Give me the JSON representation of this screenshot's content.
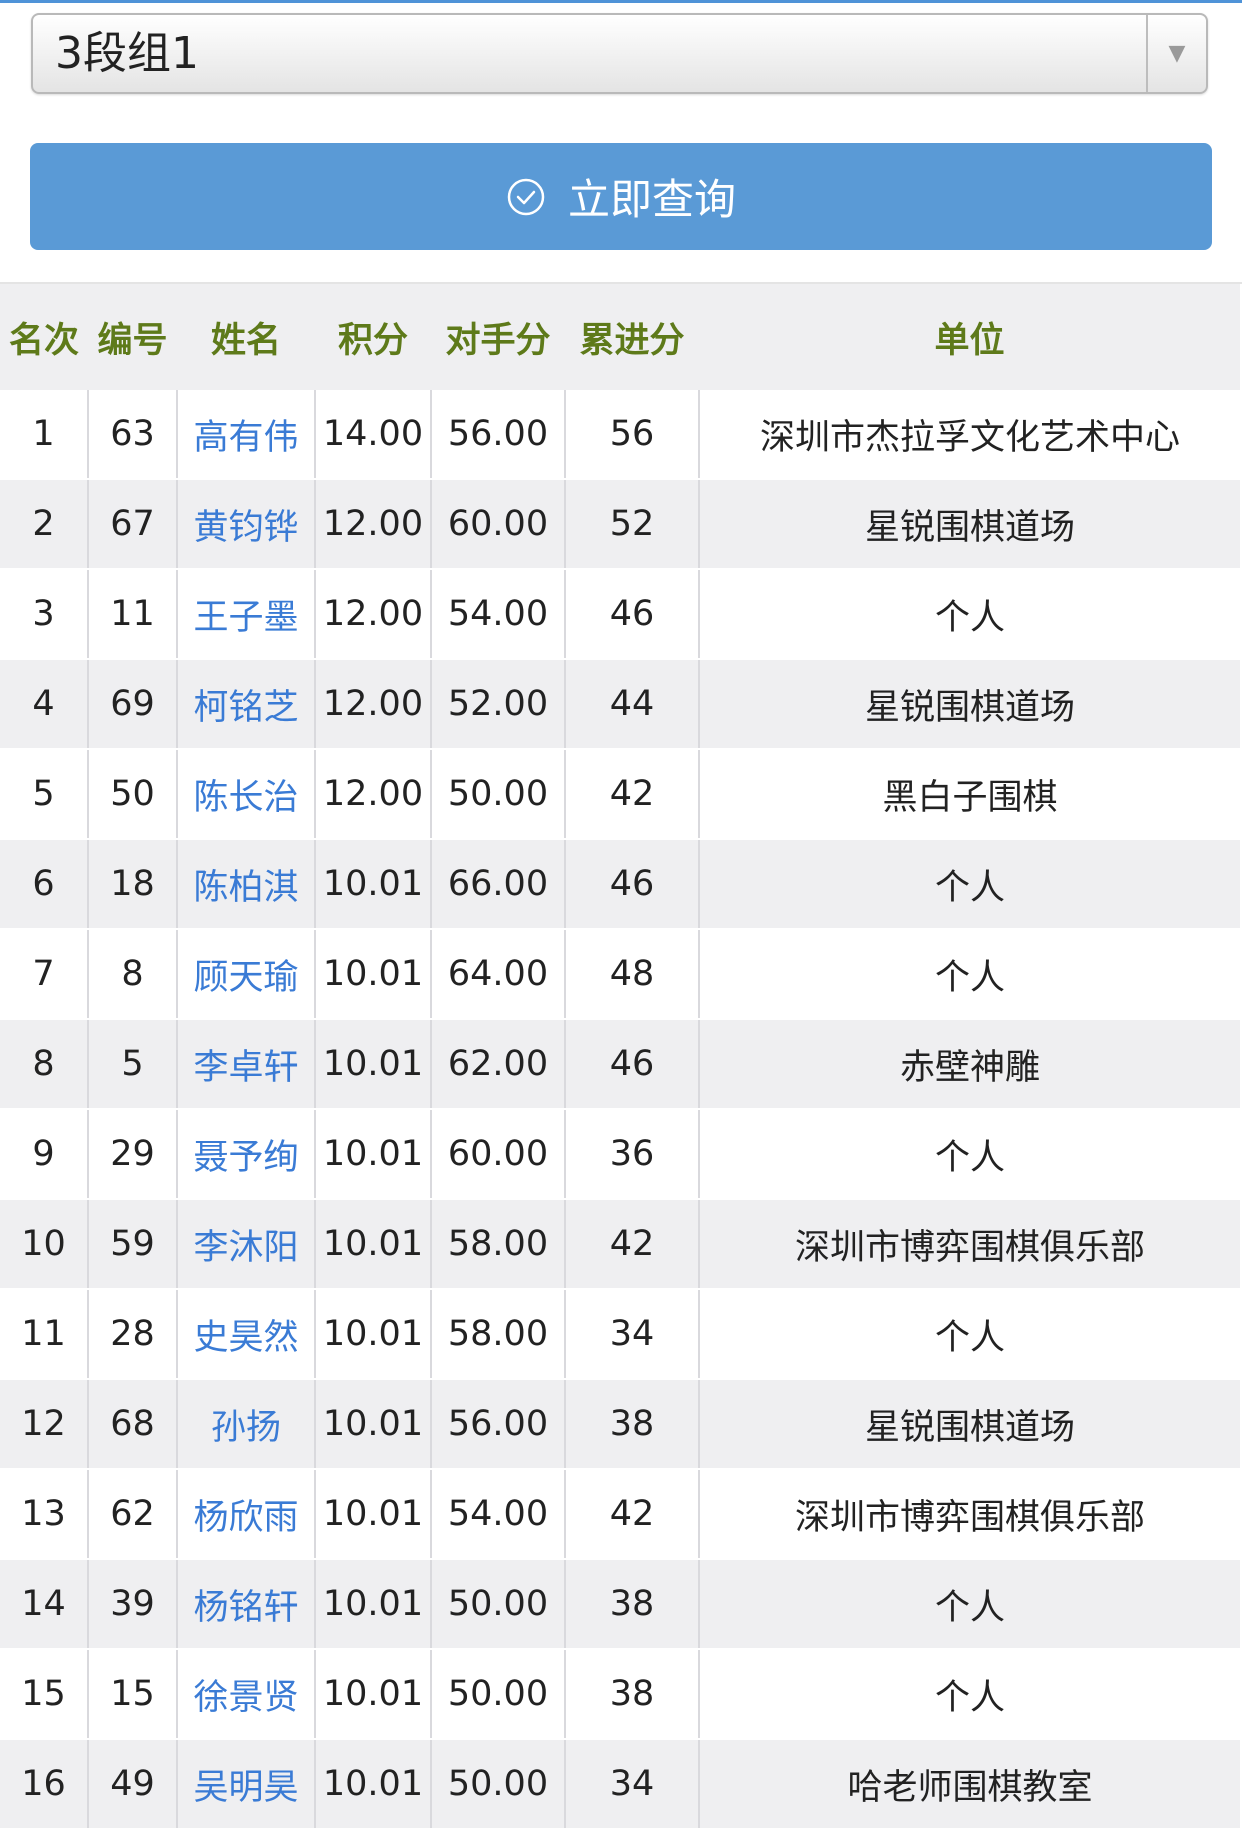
{
  "filter": {
    "selected_group": "3段组1"
  },
  "query_button": {
    "label": "立即查询",
    "icon": "check-circle-icon"
  },
  "table": {
    "headers": [
      "名次",
      "编号",
      "姓名",
      "积分",
      "对手分",
      "累进分",
      "单位"
    ],
    "rows": [
      {
        "rank": "1",
        "id": "63",
        "name": "高有伟",
        "score": "14.00",
        "opp": "56.00",
        "prog": "56",
        "unit": "深圳市杰拉孚文化艺术中心"
      },
      {
        "rank": "2",
        "id": "67",
        "name": "黄钧铧",
        "score": "12.00",
        "opp": "60.00",
        "prog": "52",
        "unit": "星锐围棋道场"
      },
      {
        "rank": "3",
        "id": "11",
        "name": "王子墨",
        "score": "12.00",
        "opp": "54.00",
        "prog": "46",
        "unit": "个人"
      },
      {
        "rank": "4",
        "id": "69",
        "name": "柯铭芝",
        "score": "12.00",
        "opp": "52.00",
        "prog": "44",
        "unit": "星锐围棋道场"
      },
      {
        "rank": "5",
        "id": "50",
        "name": "陈长治",
        "score": "12.00",
        "opp": "50.00",
        "prog": "42",
        "unit": "黑白子围棋"
      },
      {
        "rank": "6",
        "id": "18",
        "name": "陈柏淇",
        "score": "10.01",
        "opp": "66.00",
        "prog": "46",
        "unit": "个人"
      },
      {
        "rank": "7",
        "id": "8",
        "name": "顾天瑜",
        "score": "10.01",
        "opp": "64.00",
        "prog": "48",
        "unit": "个人"
      },
      {
        "rank": "8",
        "id": "5",
        "name": "李卓轩",
        "score": "10.01",
        "opp": "62.00",
        "prog": "46",
        "unit": "赤壁神雕"
      },
      {
        "rank": "9",
        "id": "29",
        "name": "聂予绚",
        "score": "10.01",
        "opp": "60.00",
        "prog": "36",
        "unit": "个人"
      },
      {
        "rank": "10",
        "id": "59",
        "name": "李沐阳",
        "score": "10.01",
        "opp": "58.00",
        "prog": "42",
        "unit": "深圳市博弈围棋俱乐部"
      },
      {
        "rank": "11",
        "id": "28",
        "name": "史昊然",
        "score": "10.01",
        "opp": "58.00",
        "prog": "34",
        "unit": "个人"
      },
      {
        "rank": "12",
        "id": "68",
        "name": "孙扬",
        "score": "10.01",
        "opp": "56.00",
        "prog": "38",
        "unit": "星锐围棋道场"
      },
      {
        "rank": "13",
        "id": "62",
        "name": "杨欣雨",
        "score": "10.01",
        "opp": "54.00",
        "prog": "42",
        "unit": "深圳市博弈围棋俱乐部"
      },
      {
        "rank": "14",
        "id": "39",
        "name": "杨铭轩",
        "score": "10.01",
        "opp": "50.00",
        "prog": "38",
        "unit": "个人"
      },
      {
        "rank": "15",
        "id": "15",
        "name": "徐景贤",
        "score": "10.01",
        "opp": "50.00",
        "prog": "38",
        "unit": "个人"
      },
      {
        "rank": "16",
        "id": "49",
        "name": "吴明昊",
        "score": "10.01",
        "opp": "50.00",
        "prog": "34",
        "unit": "哈老师围棋教室"
      }
    ]
  },
  "colors": {
    "accent": "#5a9ad6",
    "header_text": "#5e7a1a",
    "name_link": "#3a7bd5",
    "stripe": "#efeff1"
  }
}
